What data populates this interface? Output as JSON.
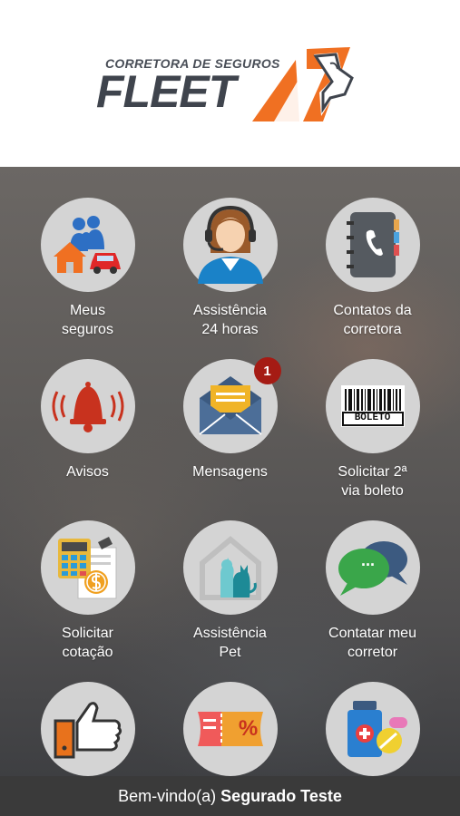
{
  "brand": {
    "subtitle": "CORRETORA DE SEGUROS",
    "name": "FLEET",
    "accent_color": "#f07022",
    "text_color": "#3f444d"
  },
  "menu": [
    {
      "line1": "Meus",
      "line2": "seguros",
      "icon": "family-house-car-icon"
    },
    {
      "line1": "Assistência",
      "line2": "24 horas",
      "icon": "headset-agent-icon"
    },
    {
      "line1": "Contatos da",
      "line2": "corretora",
      "icon": "phone-book-icon"
    },
    {
      "line1": "Avisos",
      "line2": "",
      "icon": "bell-icon"
    },
    {
      "line1": "Mensagens",
      "line2": "",
      "icon": "envelope-icon",
      "badge": "1"
    },
    {
      "line1": "Solicitar 2ª",
      "line2": "via boleto",
      "icon": "barcode-icon",
      "barcode_text": "BOLETO"
    },
    {
      "line1": "Solicitar",
      "line2": "cotação",
      "icon": "calculator-document-icon"
    },
    {
      "line1": "Assistência",
      "line2": "Pet",
      "icon": "pet-house-icon"
    },
    {
      "line1": "Contatar meu",
      "line2": "corretor",
      "icon": "chat-bubbles-icon",
      "chat_text": "..."
    },
    {
      "line1": "",
      "line2": "",
      "icon": "thumbs-up-icon"
    },
    {
      "line1": "",
      "line2": "",
      "icon": "discount-ticket-icon",
      "ticket_text": "%"
    },
    {
      "line1": "",
      "line2": "",
      "icon": "medicine-icon"
    }
  ],
  "footer": {
    "greeting": "Bem-vindo(a)",
    "user_name": "Segurado Teste"
  },
  "colors": {
    "badge": "#a51b14",
    "footer_bg": "#3a3a3a",
    "tile_circle": "#d4d4d4"
  }
}
